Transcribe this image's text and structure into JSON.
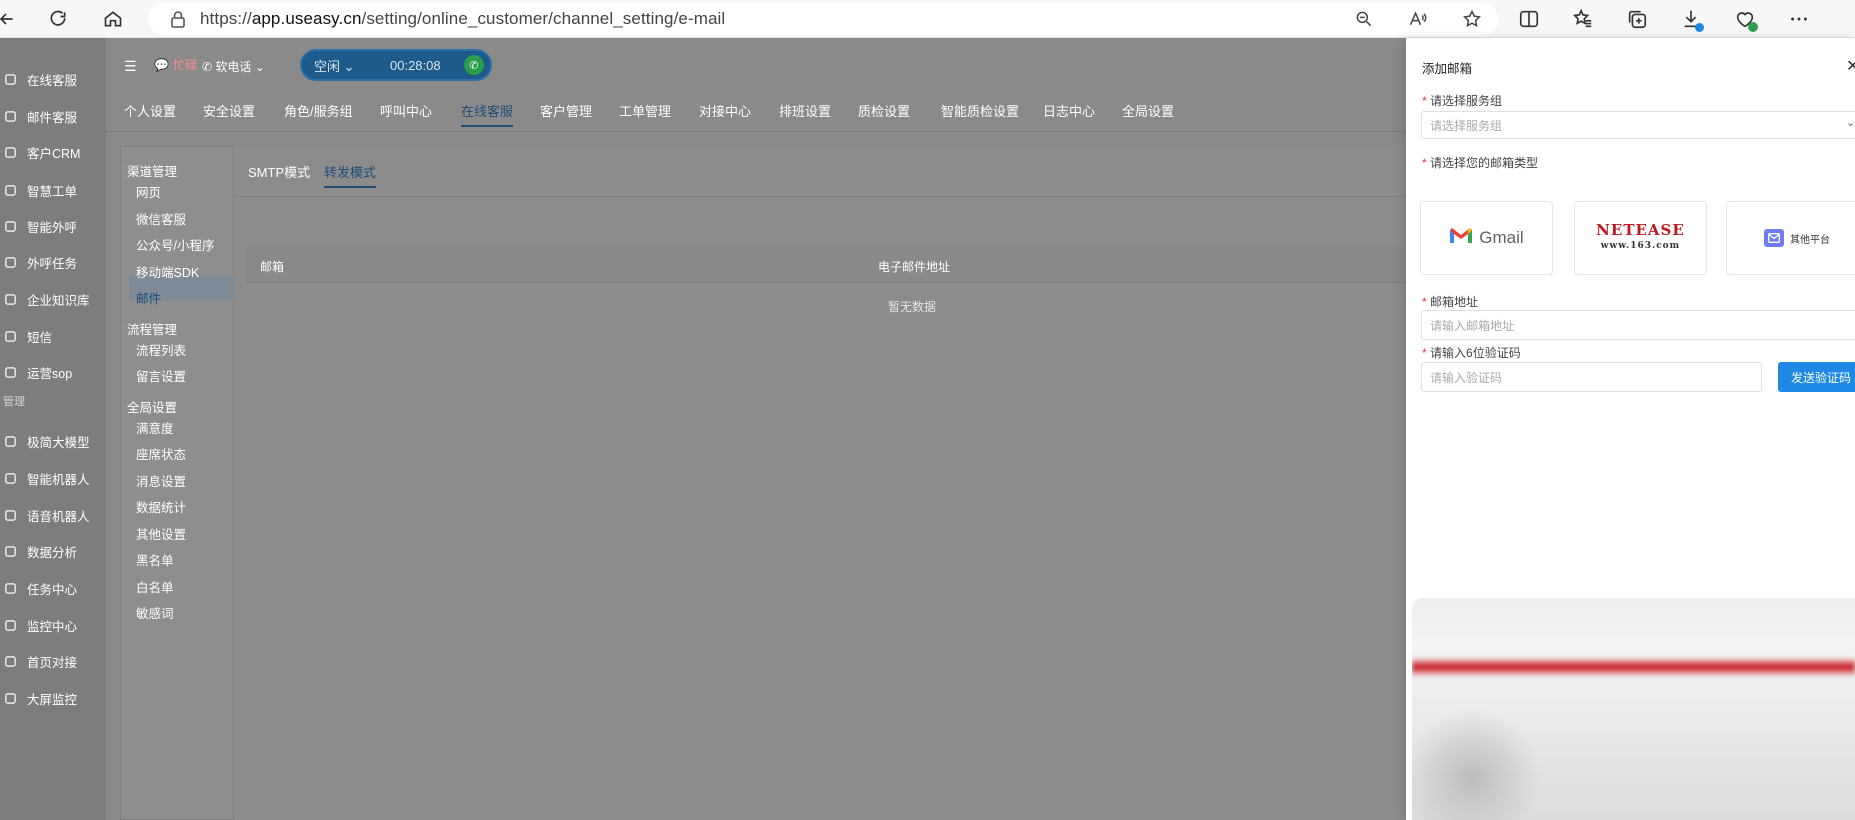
{
  "browser": {
    "url_prefix": "https://",
    "url_domain": "app.useasy.cn",
    "url_path": "/setting/online_customer/channel_setting/e-mail"
  },
  "sidebar": {
    "items": [
      {
        "label": "在线客服",
        "icon": "headset-icon"
      },
      {
        "label": "邮件客服",
        "icon": "mail-icon"
      },
      {
        "label": "客户CRM",
        "icon": "user-icon"
      },
      {
        "label": "智慧工单",
        "icon": "ticket-icon"
      },
      {
        "label": "智能外呼",
        "icon": "phone-icon"
      },
      {
        "label": "外呼任务",
        "icon": "phone-task-icon"
      },
      {
        "label": "企业知识库",
        "icon": "book-icon"
      },
      {
        "label": "短信",
        "icon": "sms-icon"
      },
      {
        "label": "运营sop",
        "icon": "flow-icon"
      }
    ],
    "section_label": "管理",
    "items2": [
      {
        "label": "极简大模型",
        "icon": "model-icon"
      },
      {
        "label": "智能机器人",
        "icon": "robot-icon"
      },
      {
        "label": "语音机器人",
        "icon": "voice-robot-icon"
      },
      {
        "label": "数据分析",
        "icon": "chart-icon"
      },
      {
        "label": "任务中心",
        "icon": "task-icon"
      },
      {
        "label": "监控中心",
        "icon": "monitor-icon"
      },
      {
        "label": "首页对接",
        "icon": "home-link-icon"
      },
      {
        "label": "大屏监控",
        "icon": "screen-icon"
      }
    ]
  },
  "topbar": {
    "busy_label": "忙碌",
    "phone_label": "软电话",
    "status": "空闲",
    "timer": "00:28:08"
  },
  "tabs": [
    "个人设置",
    "安全设置",
    "角色/服务组",
    "呼叫中心",
    "在线客服",
    "客户管理",
    "工单管理",
    "对接中心",
    "排班设置",
    "质检设置",
    "智能质检设置",
    "日志中心",
    "全局设置"
  ],
  "active_tab": "在线客服",
  "subnav": {
    "groups": [
      {
        "label": "渠道管理",
        "items": [
          "网页",
          "微信客服",
          "公众号/小程序",
          "移动端SDK",
          "邮件"
        ]
      },
      {
        "label": "流程管理",
        "items": [
          "流程列表",
          "留言设置"
        ]
      },
      {
        "label": "全局设置",
        "items": [
          "满意度",
          "座席状态",
          "消息设置",
          "数据统计",
          "其他设置",
          "黑名单",
          "白名单",
          "敏感词"
        ]
      }
    ],
    "active_item": "邮件"
  },
  "content": {
    "mode_tabs": [
      "SMTP模式",
      "转发模式"
    ],
    "active_mode": "转发模式",
    "columns": [
      "邮箱",
      "电子邮件地址"
    ],
    "empty_text": "暂无数据"
  },
  "drawer": {
    "title": "添加邮箱",
    "service_group_label": "请选择服务组",
    "service_group_placeholder": "请选择服务组",
    "mail_type_label": "请选择您的邮箱类型",
    "mail_types": [
      "Gmail",
      "NetEase 163",
      "其他平台"
    ],
    "gmail_text": "Gmail",
    "netease_text": "NETEASE",
    "netease_sub": "www.163.com",
    "other_text": "其他平台",
    "email_label": "邮箱地址",
    "email_placeholder": "请输入邮箱地址",
    "code_label": "请输入6位验证码",
    "code_placeholder": "请输入验证码",
    "send_button": "发送验证码"
  },
  "colors": {
    "primary": "#1e88e5",
    "accent_dark": "#1f4e79",
    "required": "#e53935",
    "gmail_red": "#ea4335",
    "netease_red": "#c0181f",
    "other_icon": "#6d7cf3"
  }
}
